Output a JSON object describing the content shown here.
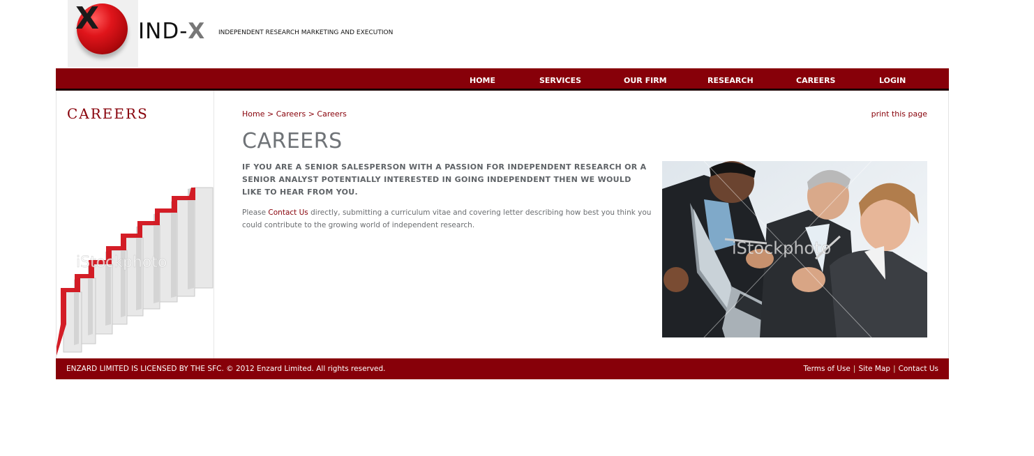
{
  "brand": {
    "logo_letter": "X",
    "name_main": "IND-",
    "name_accent": "X",
    "tagline": "INDEPENDENT RESEARCH MARKETING AND EXECUTION"
  },
  "nav": {
    "items": [
      {
        "label": "HOME"
      },
      {
        "label": "SERVICES"
      },
      {
        "label": "OUR FIRM"
      },
      {
        "label": "RESEARCH"
      },
      {
        "label": "CAREERS"
      },
      {
        "label": "LOGIN"
      }
    ]
  },
  "sidebar": {
    "title": "CAREERS",
    "image_watermark": "iStockphoto"
  },
  "breadcrumb": {
    "items": [
      "Home",
      "Careers",
      "Careers"
    ],
    "separator": ">"
  },
  "print_link": "print this page",
  "main": {
    "title": "CAREERS",
    "intro": "IF YOU ARE A SENIOR SALESPERSON WITH A PASSION FOR INDEPENDENT RESEARCH OR A SENIOR ANALYST POTENTIALLY INTERESTED IN GOING INDEPENDENT THEN WE WOULD LIKE TO HEAR FROM YOU.",
    "body_before": "Please ",
    "body_link": "Contact Us",
    "body_after": " directly, submitting a curriculum vitae and covering letter describing how best you think you could contribute to the growing world of independent research.",
    "photo_watermark": "iStockphoto"
  },
  "footer": {
    "copyright": "ENZARD LIMITED IS LICENSED BY THE SFC. © 2012 Enzard Limited. All rights reserved.",
    "links": [
      "Terms of Use",
      "Site Map",
      "Contact Us"
    ],
    "separator": "|"
  },
  "colors": {
    "brand_red": "#870009",
    "title_grey": "#6f7377",
    "text_grey": "#6a6d70"
  }
}
